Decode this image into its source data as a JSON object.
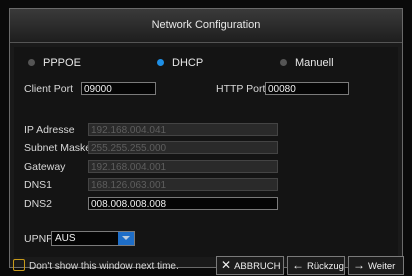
{
  "dialog": {
    "title": "Network Configuration"
  },
  "modes": {
    "pppoe": {
      "label": "PPPOE",
      "selected": false
    },
    "dhcp": {
      "label": "DHCP",
      "selected": true
    },
    "manual": {
      "label": "Manuell",
      "selected": false
    }
  },
  "ports": {
    "client_label": "Client Port",
    "client_value": "09000",
    "http_label": "HTTP Port",
    "http_value": "00080"
  },
  "network": {
    "ip_label": "IP Adresse",
    "ip_value": "192.168.004.041",
    "subnet_label": "Subnet Maske",
    "subnet_value": "255.255.255.000",
    "gateway_label": "Gateway",
    "gateway_value": "192.168.004.001",
    "dns1_label": "DNS1",
    "dns1_value": "168.126.063.001",
    "dns2_label": "DNS2",
    "dns2_value": "008.008.008.008"
  },
  "upnp": {
    "label": "UPNP",
    "value": "AUS"
  },
  "footer": {
    "dont_show_label": "Don't show this window next time.",
    "cancel_label": "ABBRUCH",
    "back_label": "Rückzug",
    "next_label": "Weiter"
  },
  "colors": {
    "accent": "#1e8fe6",
    "dropdown_arrow": "#1e6ec8",
    "checkbox_border": "#c89a1a"
  }
}
